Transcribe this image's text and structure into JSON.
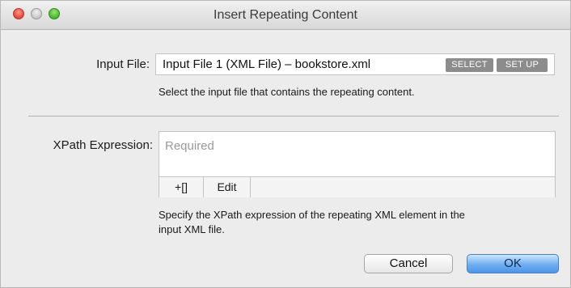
{
  "window": {
    "title": "Insert Repeating Content"
  },
  "input_file": {
    "label": "Input File:",
    "value": "Input File 1 (XML File) – bookstore.xml",
    "select_label": "SELECT",
    "setup_label": "SET UP",
    "hint": "Select the input file that contains the repeating content."
  },
  "xpath": {
    "label": "XPath Expression:",
    "placeholder": "Required",
    "insert_label": "+[]",
    "edit_label": "Edit",
    "hint_line1": "Specify the XPath expression of the repeating XML element in the",
    "hint_line2": "input XML file."
  },
  "buttons": {
    "cancel": "Cancel",
    "ok": "OK"
  }
}
